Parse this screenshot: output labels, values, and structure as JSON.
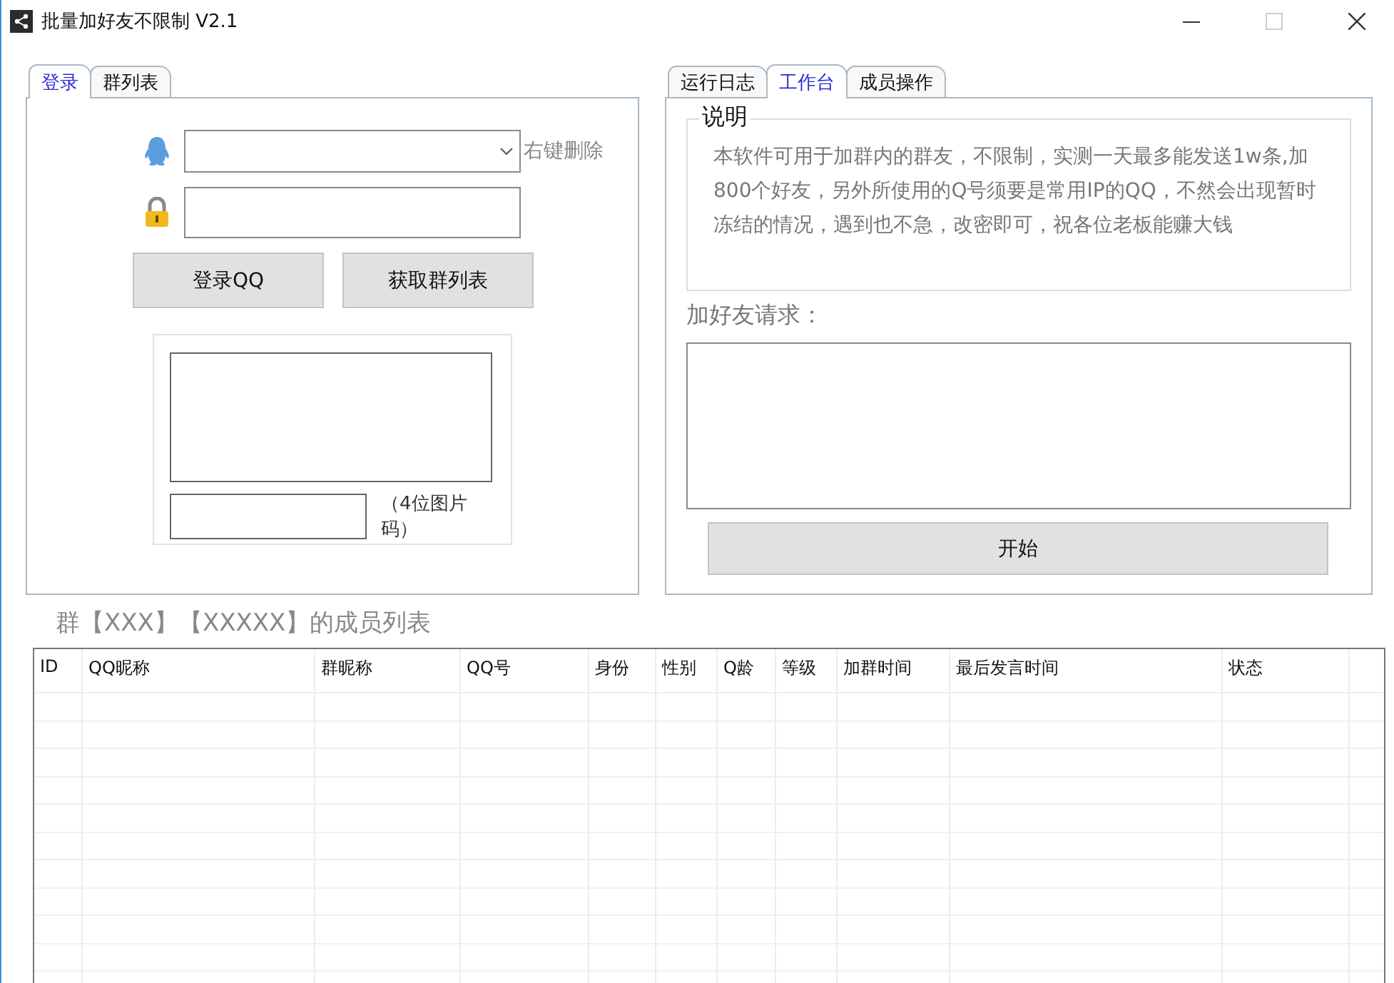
{
  "window": {
    "title": "批量加好友不限制 V2.1"
  },
  "left_tabs": [
    {
      "label": "登录",
      "selected": true
    },
    {
      "label": "群列表",
      "selected": false
    }
  ],
  "login": {
    "account_hint": "右键删除",
    "buttons": [
      "登录QQ",
      "获取群列表"
    ],
    "captcha_hint": "（4位图片码）"
  },
  "right_tabs": [
    {
      "label": "运行日志",
      "selected": false
    },
    {
      "label": "工作台",
      "selected": true
    },
    {
      "label": "成员操作",
      "selected": false
    }
  ],
  "notice": {
    "title": "说明",
    "text": "本软件可用于加群内的群友，不限制，实测一天最多能发送1w条,加800个好友，另外所使用的Q号须要是常用IP的QQ，不然会出现暂时冻结的情况，遇到也不急，改密即可，祝各位老板能赚大钱"
  },
  "request": {
    "label": "加好友请求："
  },
  "start_button": "开始",
  "members": {
    "title": "群【XXX】【XXXXX】的成员列表",
    "columns": [
      "ID",
      "QQ昵称",
      "群昵称",
      "QQ号",
      "身份",
      "性别",
      "Q龄",
      "等级",
      "加群时间",
      "最后发言时间",
      "状态"
    ]
  }
}
